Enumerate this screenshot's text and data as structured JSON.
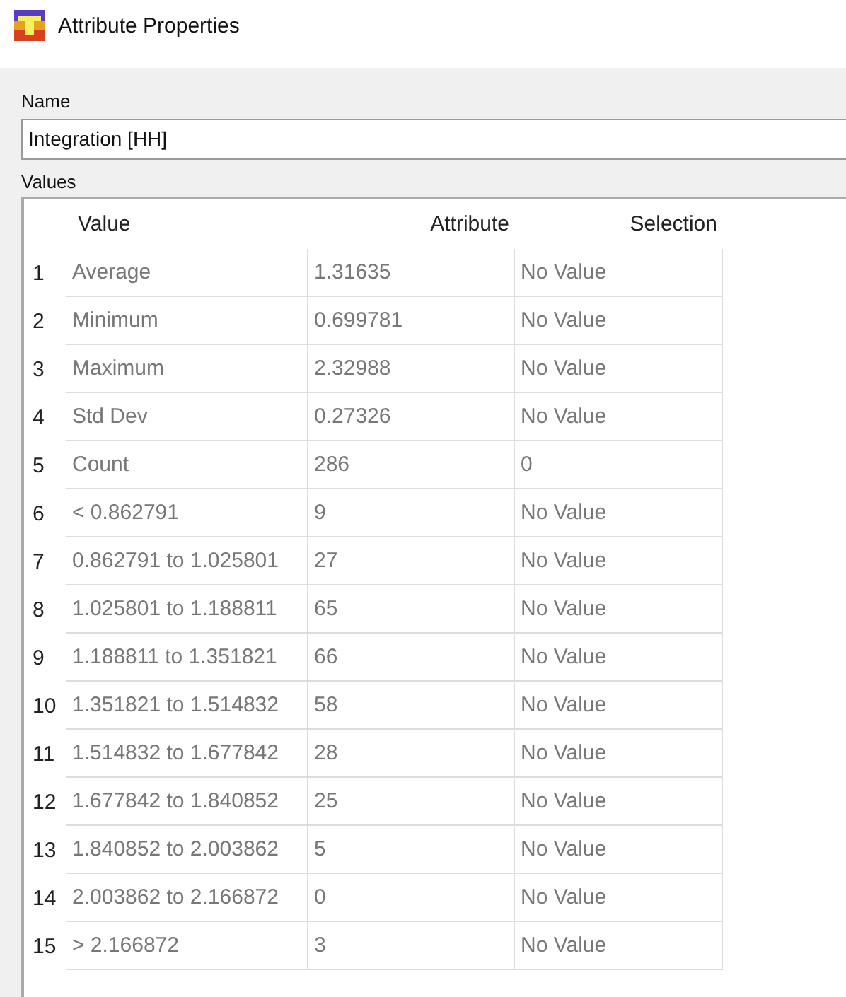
{
  "window": {
    "title": "Attribute Properties"
  },
  "name_field": {
    "label": "Name",
    "value": "Integration [HH]"
  },
  "values": {
    "label": "Values",
    "columns": [
      "Value",
      "Attribute",
      "Selection"
    ],
    "rows": [
      {
        "index": "1",
        "value": "Average",
        "attribute": "1.31635",
        "selection": "No Value"
      },
      {
        "index": "2",
        "value": "Minimum",
        "attribute": "0.699781",
        "selection": "No Value"
      },
      {
        "index": "3",
        "value": "Maximum",
        "attribute": "2.32988",
        "selection": "No Value"
      },
      {
        "index": "4",
        "value": "Std Dev",
        "attribute": "0.27326",
        "selection": "No Value"
      },
      {
        "index": "5",
        "value": "Count",
        "attribute": "286",
        "selection": "0"
      },
      {
        "index": "6",
        "value": "< 0.862791",
        "attribute": "9",
        "selection": "No Value"
      },
      {
        "index": "7",
        "value": "0.862791 to 1.025801",
        "attribute": "27",
        "selection": "No Value"
      },
      {
        "index": "8",
        "value": "1.025801 to 1.188811",
        "attribute": "65",
        "selection": "No Value"
      },
      {
        "index": "9",
        "value": "1.188811 to 1.351821",
        "attribute": "66",
        "selection": "No Value"
      },
      {
        "index": "10",
        "value": "1.351821 to 1.514832",
        "attribute": "58",
        "selection": "No Value"
      },
      {
        "index": "11",
        "value": "1.514832 to 1.677842",
        "attribute": "28",
        "selection": "No Value"
      },
      {
        "index": "12",
        "value": "1.677842 to 1.840852",
        "attribute": "25",
        "selection": "No Value"
      },
      {
        "index": "13",
        "value": "1.840852 to 2.003862",
        "attribute": "5",
        "selection": "No Value"
      },
      {
        "index": "14",
        "value": "2.003862 to 2.166872",
        "attribute": "0",
        "selection": "No Value"
      },
      {
        "index": "15",
        "value": "> 2.166872",
        "attribute": "3",
        "selection": "No Value"
      }
    ]
  }
}
